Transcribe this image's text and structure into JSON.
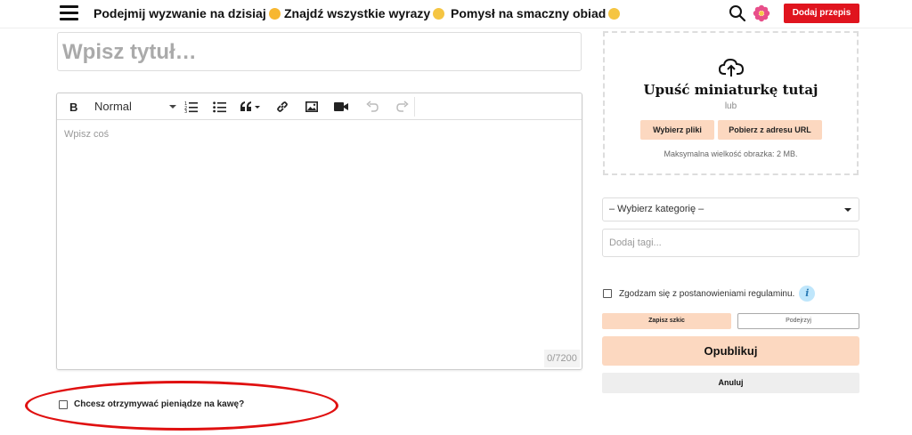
{
  "topnav": {
    "links": [
      {
        "label": "Podejmij wyzwanie na dzisiaj",
        "emoji": "party-face-icon"
      },
      {
        "label": "Znajdź wszystkie wyrazy",
        "emoji": "smirk-face-icon"
      },
      {
        "label": "Pomysł na smaczny obiad",
        "emoji": "smile-face-icon"
      }
    ],
    "add_recipe_label": "Dodaj przepis"
  },
  "editor": {
    "title_placeholder": "Wpisz tytuł…",
    "format_value": "Normal",
    "body_placeholder": "Wpisz coś",
    "counter": "0/7200"
  },
  "coffee": {
    "label": "Chcesz otrzymywać pieniądze na kawę?"
  },
  "thumbnail": {
    "title": "Upuść miniaturkę tutaj",
    "or": "lub",
    "choose_files": "Wybierz pliki",
    "from_url": "Pobierz z adresu URL",
    "max_size": "Maksymalna wielkość obrazka: 2 MB."
  },
  "sidebar": {
    "category_value": "– Wybierz kategorię –",
    "tags_placeholder": "Dodaj tagi...",
    "terms_label": "Zgodzam się z postanowieniami regulaminu.",
    "info_glyph": "i",
    "save_draft": "Zapisz szkic",
    "preview": "Podejrzyj",
    "publish": "Opublikuj",
    "cancel": "Anuluj"
  },
  "colors": {
    "accent_red": "#e0141e",
    "peach": "#fcd8c0",
    "annotation_red": "#e01010"
  }
}
